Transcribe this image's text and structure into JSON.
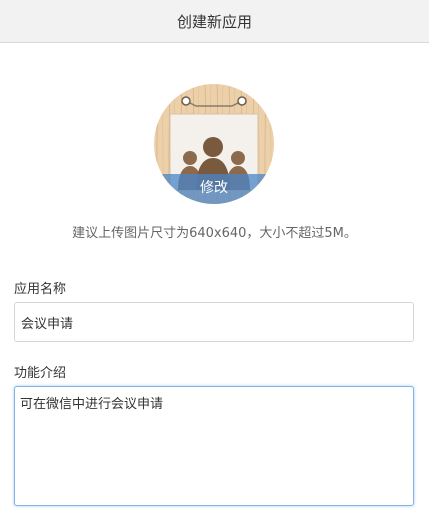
{
  "header": {
    "title": "创建新应用"
  },
  "avatar": {
    "icon": "app-image-placeholder-icon",
    "edit_label": "修改"
  },
  "hint": {
    "text": "建议上传图片尺寸为640x640，大小不超过5M。"
  },
  "form": {
    "name_label": "应用名称",
    "name_value": "会议申请",
    "desc_label": "功能介绍",
    "desc_value": "可在微信中进行会议申请"
  },
  "colors": {
    "header_bg": "#f2f2f2",
    "focus_border": "#7fb4e6",
    "avatar_overlay": "#4a86c8",
    "wood": "#e8c9a0"
  }
}
